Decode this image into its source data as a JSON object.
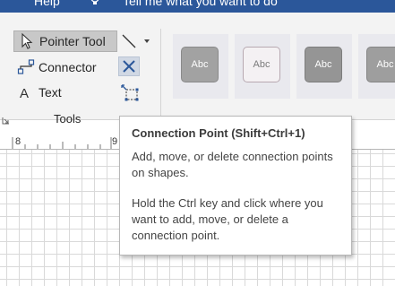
{
  "topbar": {
    "help_label": "Help",
    "tell_me_placeholder": "Tell me what you want to do",
    "bulb_icon": "lightbulb-icon",
    "bg_color": "#2b579a"
  },
  "tools": {
    "pointer_label": "Pointer Tool",
    "connector_label": "Connector",
    "text_label": "Text",
    "group_label": "Tools",
    "pointer_icon": "pointer-icon",
    "connector_icon": "connector-icon",
    "text_icon": "text-icon",
    "line_icon": "line-tool-icon",
    "delete_icon": "close-icon",
    "connection_point_icon": "connection-point-icon"
  },
  "gallery": {
    "items": [
      {
        "label": "Abc"
      },
      {
        "label": "Abc"
      },
      {
        "label": "Abc"
      },
      {
        "label": "Abc"
      }
    ]
  },
  "ruler": {
    "labels": [
      "8",
      "9"
    ]
  },
  "tooltip": {
    "title": "Connection Point (Shift+Ctrl+1)",
    "line1": "Add, move, or delete connection points on shapes.",
    "line2": "Hold the Ctrl key and click where you want to add, move, or delete a connection point."
  }
}
